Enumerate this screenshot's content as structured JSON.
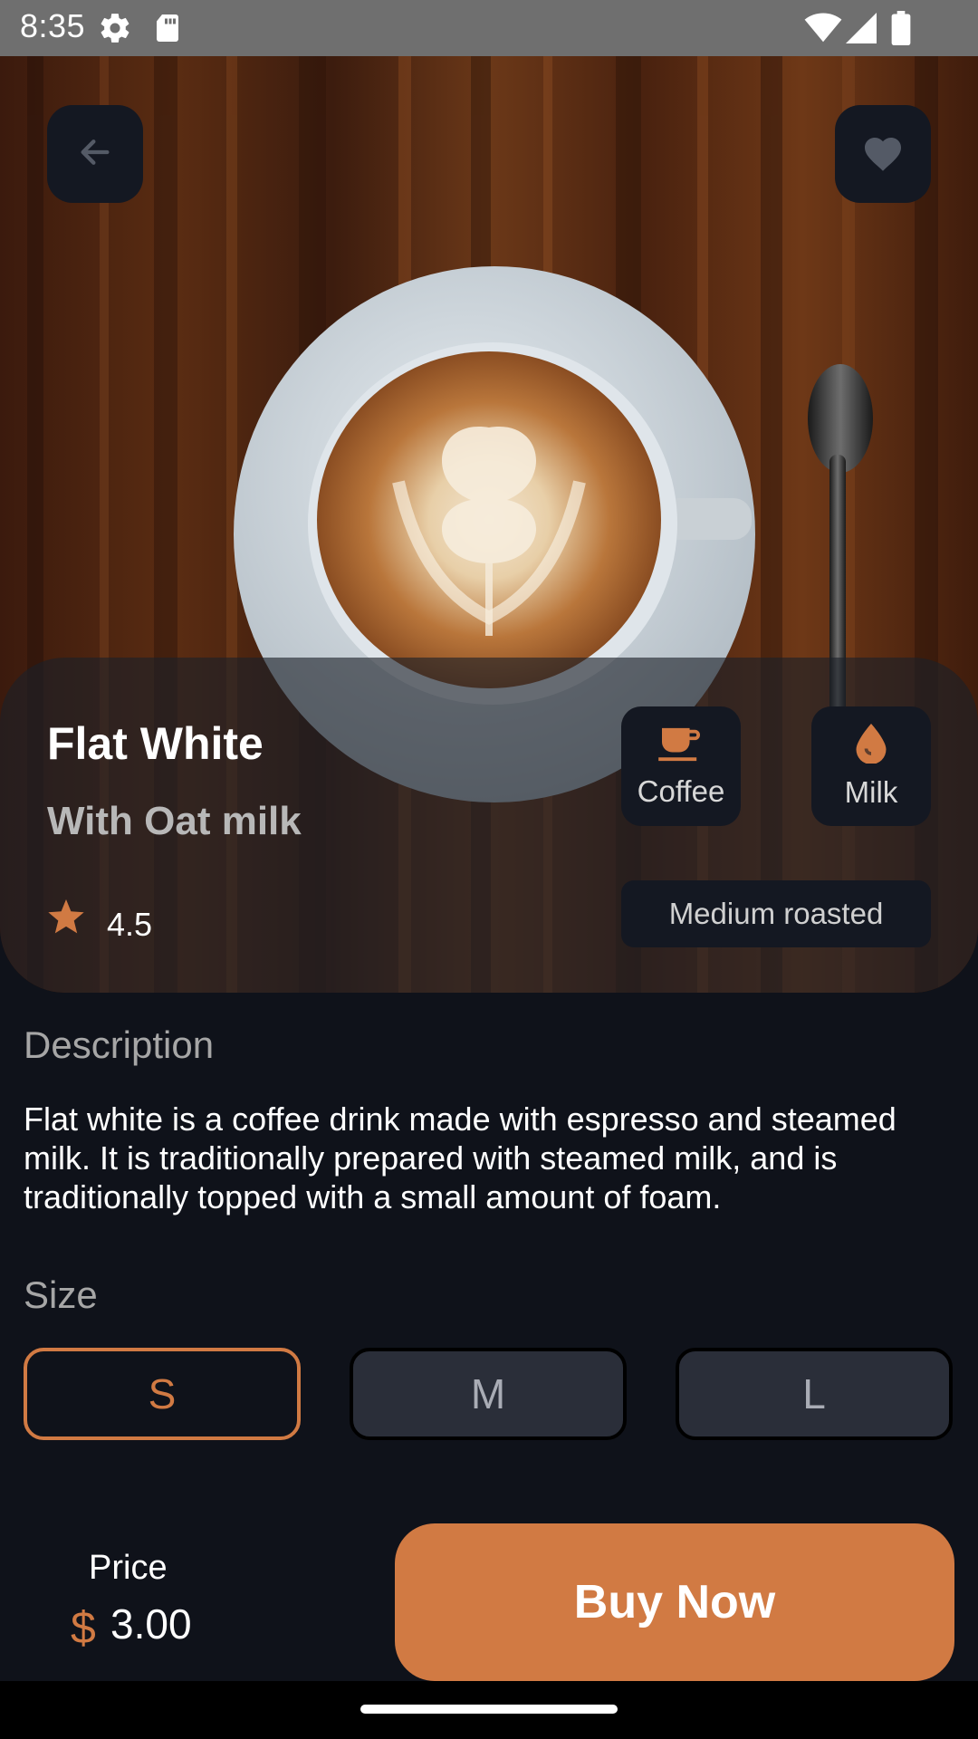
{
  "status_bar": {
    "time": "8:35",
    "icons": [
      "settings-icon",
      "sd-card-icon",
      "wifi-icon",
      "signal-icon",
      "battery-icon"
    ]
  },
  "hero": {
    "back_icon": "arrow-left-icon",
    "favorite_icon": "heart-icon",
    "title": "Flat White",
    "subtitle": "With Oat milk",
    "rating": "4.5",
    "rating_icon": "star-icon",
    "chips": [
      {
        "label": "Coffee",
        "icon": "coffee-cup-icon"
      },
      {
        "label": "Milk",
        "icon": "drop-icon"
      }
    ],
    "roast": "Medium roasted"
  },
  "description": {
    "heading": "Description",
    "text": "Flat white is a coffee drink made with espresso and steamed milk. It is traditionally prepared with steamed milk, and is traditionally topped with a small amount of foam."
  },
  "size": {
    "heading": "Size",
    "options": [
      "S",
      "M",
      "L"
    ],
    "selected": "S"
  },
  "footer": {
    "price_label": "Price",
    "currency": "$",
    "price": "3.00",
    "buy_label": "Buy Now"
  },
  "colors": {
    "accent": "#d17a43",
    "background": "#0f121a",
    "surface": "#141822",
    "size_button": "#2a2e39"
  }
}
